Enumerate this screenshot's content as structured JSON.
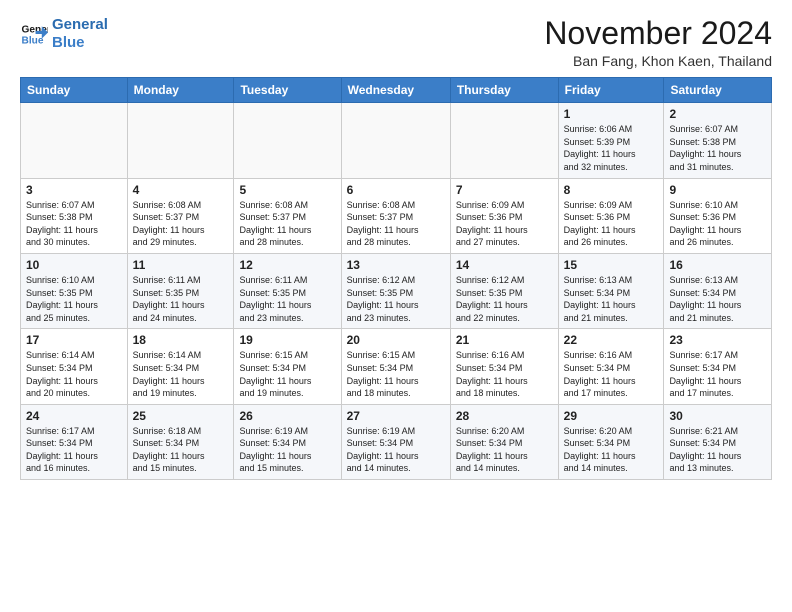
{
  "logo": {
    "line1": "General",
    "line2": "Blue"
  },
  "title": "November 2024",
  "location": "Ban Fang, Khon Kaen, Thailand",
  "days_of_week": [
    "Sunday",
    "Monday",
    "Tuesday",
    "Wednesday",
    "Thursday",
    "Friday",
    "Saturday"
  ],
  "weeks": [
    [
      {
        "day": "",
        "info": ""
      },
      {
        "day": "",
        "info": ""
      },
      {
        "day": "",
        "info": ""
      },
      {
        "day": "",
        "info": ""
      },
      {
        "day": "",
        "info": ""
      },
      {
        "day": "1",
        "info": "Sunrise: 6:06 AM\nSunset: 5:39 PM\nDaylight: 11 hours\nand 32 minutes."
      },
      {
        "day": "2",
        "info": "Sunrise: 6:07 AM\nSunset: 5:38 PM\nDaylight: 11 hours\nand 31 minutes."
      }
    ],
    [
      {
        "day": "3",
        "info": "Sunrise: 6:07 AM\nSunset: 5:38 PM\nDaylight: 11 hours\nand 30 minutes."
      },
      {
        "day": "4",
        "info": "Sunrise: 6:08 AM\nSunset: 5:37 PM\nDaylight: 11 hours\nand 29 minutes."
      },
      {
        "day": "5",
        "info": "Sunrise: 6:08 AM\nSunset: 5:37 PM\nDaylight: 11 hours\nand 28 minutes."
      },
      {
        "day": "6",
        "info": "Sunrise: 6:08 AM\nSunset: 5:37 PM\nDaylight: 11 hours\nand 28 minutes."
      },
      {
        "day": "7",
        "info": "Sunrise: 6:09 AM\nSunset: 5:36 PM\nDaylight: 11 hours\nand 27 minutes."
      },
      {
        "day": "8",
        "info": "Sunrise: 6:09 AM\nSunset: 5:36 PM\nDaylight: 11 hours\nand 26 minutes."
      },
      {
        "day": "9",
        "info": "Sunrise: 6:10 AM\nSunset: 5:36 PM\nDaylight: 11 hours\nand 26 minutes."
      }
    ],
    [
      {
        "day": "10",
        "info": "Sunrise: 6:10 AM\nSunset: 5:35 PM\nDaylight: 11 hours\nand 25 minutes."
      },
      {
        "day": "11",
        "info": "Sunrise: 6:11 AM\nSunset: 5:35 PM\nDaylight: 11 hours\nand 24 minutes."
      },
      {
        "day": "12",
        "info": "Sunrise: 6:11 AM\nSunset: 5:35 PM\nDaylight: 11 hours\nand 23 minutes."
      },
      {
        "day": "13",
        "info": "Sunrise: 6:12 AM\nSunset: 5:35 PM\nDaylight: 11 hours\nand 23 minutes."
      },
      {
        "day": "14",
        "info": "Sunrise: 6:12 AM\nSunset: 5:35 PM\nDaylight: 11 hours\nand 22 minutes."
      },
      {
        "day": "15",
        "info": "Sunrise: 6:13 AM\nSunset: 5:34 PM\nDaylight: 11 hours\nand 21 minutes."
      },
      {
        "day": "16",
        "info": "Sunrise: 6:13 AM\nSunset: 5:34 PM\nDaylight: 11 hours\nand 21 minutes."
      }
    ],
    [
      {
        "day": "17",
        "info": "Sunrise: 6:14 AM\nSunset: 5:34 PM\nDaylight: 11 hours\nand 20 minutes."
      },
      {
        "day": "18",
        "info": "Sunrise: 6:14 AM\nSunset: 5:34 PM\nDaylight: 11 hours\nand 19 minutes."
      },
      {
        "day": "19",
        "info": "Sunrise: 6:15 AM\nSunset: 5:34 PM\nDaylight: 11 hours\nand 19 minutes."
      },
      {
        "day": "20",
        "info": "Sunrise: 6:15 AM\nSunset: 5:34 PM\nDaylight: 11 hours\nand 18 minutes."
      },
      {
        "day": "21",
        "info": "Sunrise: 6:16 AM\nSunset: 5:34 PM\nDaylight: 11 hours\nand 18 minutes."
      },
      {
        "day": "22",
        "info": "Sunrise: 6:16 AM\nSunset: 5:34 PM\nDaylight: 11 hours\nand 17 minutes."
      },
      {
        "day": "23",
        "info": "Sunrise: 6:17 AM\nSunset: 5:34 PM\nDaylight: 11 hours\nand 17 minutes."
      }
    ],
    [
      {
        "day": "24",
        "info": "Sunrise: 6:17 AM\nSunset: 5:34 PM\nDaylight: 11 hours\nand 16 minutes."
      },
      {
        "day": "25",
        "info": "Sunrise: 6:18 AM\nSunset: 5:34 PM\nDaylight: 11 hours\nand 15 minutes."
      },
      {
        "day": "26",
        "info": "Sunrise: 6:19 AM\nSunset: 5:34 PM\nDaylight: 11 hours\nand 15 minutes."
      },
      {
        "day": "27",
        "info": "Sunrise: 6:19 AM\nSunset: 5:34 PM\nDaylight: 11 hours\nand 14 minutes."
      },
      {
        "day": "28",
        "info": "Sunrise: 6:20 AM\nSunset: 5:34 PM\nDaylight: 11 hours\nand 14 minutes."
      },
      {
        "day": "29",
        "info": "Sunrise: 6:20 AM\nSunset: 5:34 PM\nDaylight: 11 hours\nand 14 minutes."
      },
      {
        "day": "30",
        "info": "Sunrise: 6:21 AM\nSunset: 5:34 PM\nDaylight: 11 hours\nand 13 minutes."
      }
    ]
  ]
}
